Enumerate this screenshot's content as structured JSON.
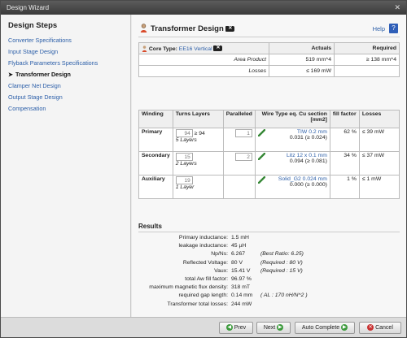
{
  "window": {
    "title": "Design Wizard",
    "close": "✕"
  },
  "sidebar": {
    "heading": "Design Steps",
    "steps": [
      {
        "label": "Converter Specifications"
      },
      {
        "label": "Input Stage Design"
      },
      {
        "label": "Flyback Parameters Specifications"
      },
      {
        "label": "Transformer Design",
        "arrow": "➤"
      },
      {
        "label": "Clamper Net Design"
      },
      {
        "label": "Output Stage Design"
      },
      {
        "label": "Compensation"
      }
    ]
  },
  "header": {
    "title": "Transformer Design",
    "help": "Help",
    "help_icon": "?"
  },
  "core": {
    "label": "Core Type:",
    "value": "EE16 Vertical",
    "col_actuals": "Actuals",
    "col_required": "Required",
    "rows": [
      {
        "name": "Area Product",
        "actual": "519 mm^4",
        "required": "≥ 138 mm^4"
      },
      {
        "name": "Losses",
        "actual": "≤ 169 mW",
        "required": ""
      }
    ]
  },
  "windings": {
    "headers": {
      "winding": "Winding",
      "turns": "Turns Layers",
      "paralleled": "Paralleled",
      "wire": "Wire Type eq. Cu section [mm2]",
      "fill": "fill factor",
      "losses": "Losses"
    },
    "rows": [
      {
        "name": "Primary",
        "turns": "94",
        "turns_req": "≥ 94",
        "layers": "5 Layers",
        "paralleled": "1",
        "wire": "TIW 0.2 mm",
        "section": "0.031 (≥ 0.024)",
        "fill": "62 %",
        "losses": "≤ 39 mW"
      },
      {
        "name": "Secondary",
        "turns": "15",
        "turns_req": "",
        "layers": "2 Layers",
        "paralleled": "2",
        "wire": "Litz 12 x 0.1 mm",
        "section": "0.094 (≥ 0.081)",
        "fill": "34 %",
        "losses": "≤ 37 mW"
      },
      {
        "name": "Auxiliary",
        "turns": "19",
        "turns_req": "",
        "layers": "1 Layer",
        "paralleled": "",
        "wire": "Solid_G2 0.024 mm",
        "section": "0.000 (≥ 0.000)",
        "fill": "1 %",
        "losses": "≤ 1 mW"
      }
    ]
  },
  "results": {
    "heading": "Results",
    "rows": [
      {
        "label": "Primary inductance:",
        "value": "1.5 mH",
        "note": ""
      },
      {
        "label": "leakage inductance:",
        "value": "45 µH",
        "note": ""
      },
      {
        "label": "Np/Ns:",
        "value": "6.267",
        "note": "(Best Ratio: 6.25)"
      },
      {
        "label": "Reflected Voltage:",
        "value": "80 V",
        "note": "(Required : 80 V)"
      },
      {
        "label": "Vaux:",
        "value": "15.41 V",
        "note": "(Required : 15 V)"
      },
      {
        "label": "total Aw fill factor:",
        "value": "96.97 %",
        "note": ""
      },
      {
        "label": "maximum magnetic flux density:",
        "value": "318 mT",
        "note": ""
      },
      {
        "label": "required gap length:",
        "value": "0.14 mm",
        "note": "( AL : 170 nH/N^2 )"
      },
      {
        "label": "Transformer total losses:",
        "value": "244 mW",
        "note": ""
      }
    ]
  },
  "footer": {
    "prev": "Prev",
    "next": "Next",
    "auto": "Auto Complete",
    "cancel": "Cancel"
  }
}
